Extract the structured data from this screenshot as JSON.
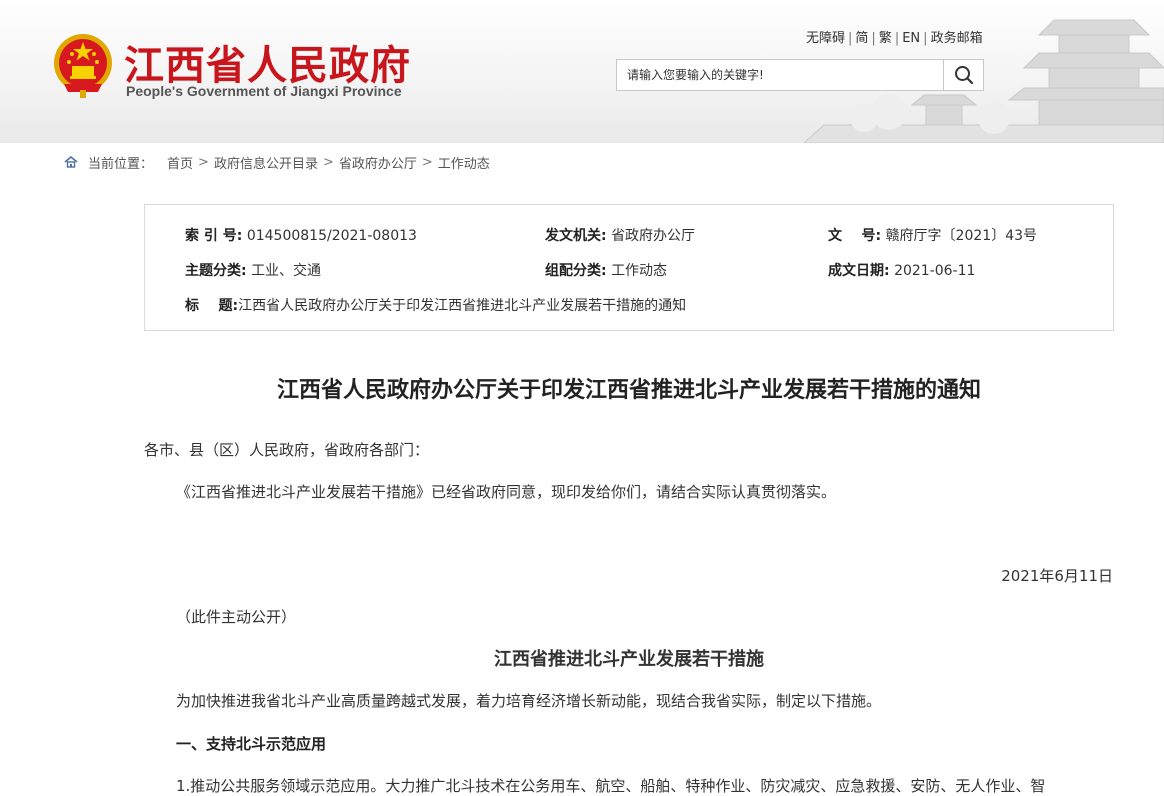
{
  "header": {
    "site_name_cn": "江西省人民政府",
    "site_name_en": "People's Government of Jiangxi Province",
    "brand_color": "#c8161d",
    "emblem_icon": "national-emblem",
    "top_links": [
      "无障碍",
      "简",
      "繁",
      "EN",
      "政务邮箱"
    ],
    "search_placeholder": "请输入您要输入的关键字!",
    "search_icon": "search-icon"
  },
  "breadcrumb": {
    "label": "当前位置：",
    "items": [
      "首页",
      "政府信息公开目录",
      "省政府办公厅",
      "工作动态"
    ]
  },
  "meta": {
    "index_label": "索 引 号:",
    "index_value": "014500815/2021-08013",
    "issuer_label": "发文机关:",
    "issuer_value": "省政府办公厅",
    "docno_label": "文    号:",
    "docno_value": "赣府厅字〔2021〕43号",
    "topic_label": "主题分类:",
    "topic_value": "工业、交通",
    "category_label": "组配分类:",
    "category_value": "工作动态",
    "date_label": "成文日期:",
    "date_value": "2021-06-11",
    "title_label": "标    题:",
    "title_value": "江西省人民政府办公厅关于印发江西省推进北斗产业发展若干措施的通知"
  },
  "article": {
    "title": "江西省人民政府办公厅关于印发江西省推进北斗产业发展若干措施的通知",
    "salutation": "各市、县（区）人民政府，省政府各部门：",
    "body": "《江西省推进北斗产业发展若干措施》已经省政府同意，现印发给你们，请结合实际认真贯彻落实。",
    "date": "2021年6月11日",
    "disclosure": "（此件主动公开）",
    "subtitle": "江西省推进北斗产业发展若干措施",
    "intro": "为加快推进我省北斗产业高质量跨越式发展，着力培育经济增长新动能，现结合我省实际，制定以下措施。",
    "section1_title": "一、支持北斗示范应用",
    "item1": "1.推动公共服务领域示范应用。大力推广北斗技术在公务用车、航空、船舶、特种作业、防灾减灾、应急救援、安防、无人作业、智"
  }
}
